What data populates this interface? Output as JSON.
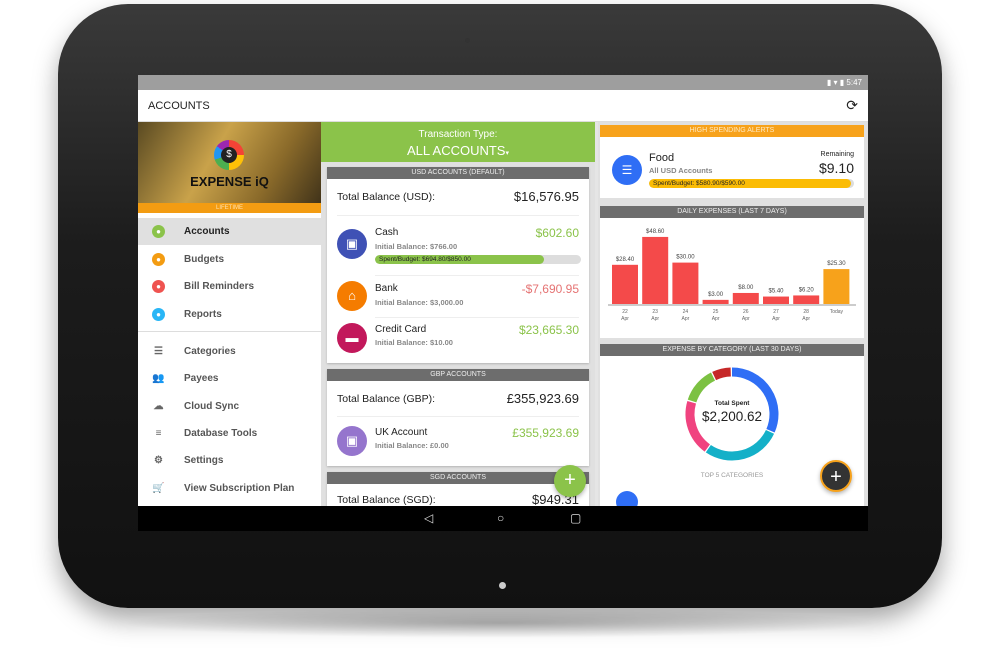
{
  "status_bar": {
    "time": "5:47"
  },
  "app_bar": {
    "title": "ACCOUNTS",
    "sync_icon": "sync-icon"
  },
  "sidebar": {
    "brand": "EXPENSE iQ",
    "plan": "LIFETIME",
    "items": [
      {
        "label": "Accounts",
        "icon": "bank-icon",
        "color": "#8bc34a",
        "active": true
      },
      {
        "label": "Budgets",
        "icon": "thumbs-up-icon",
        "color": "#f39c12"
      },
      {
        "label": "Bill Reminders",
        "icon": "alarm-icon",
        "color": "#ef5350"
      },
      {
        "label": "Reports",
        "icon": "chart-icon",
        "color": "#29b6f6"
      }
    ],
    "secondary": [
      {
        "label": "Categories",
        "icon": "list-icon"
      },
      {
        "label": "Payees",
        "icon": "people-icon"
      },
      {
        "label": "Cloud Sync",
        "icon": "cloud-icon"
      },
      {
        "label": "Database Tools",
        "icon": "database-icon"
      },
      {
        "label": "Settings",
        "icon": "gear-icon"
      },
      {
        "label": "View Subscription Plan",
        "icon": "cart-icon"
      }
    ]
  },
  "accounts": {
    "transaction_type_label": "Transaction Type:",
    "transaction_type_value": "ALL ACCOUNTS",
    "usd": {
      "header": "USD ACCOUNTS (DEFAULT)",
      "total_label": "Total Balance (USD):",
      "total": "$16,576.95",
      "items": [
        {
          "name": "Cash",
          "initial": "Initial Balance: $766.00",
          "balance": "$602.60",
          "color": "#3f51b5",
          "budget": "Spent/Budget: $694.80/$850.00",
          "budget_fraction": 0.82
        },
        {
          "name": "Bank",
          "initial": "Initial Balance: $3,000.00",
          "balance": "-$7,690.95",
          "color": "#f57c00"
        },
        {
          "name": "Credit Card",
          "initial": "Initial Balance: $10.00",
          "balance": "$23,665.30",
          "color": "#c2185b"
        }
      ]
    },
    "gbp": {
      "header": "GBP ACCOUNTS",
      "total_label": "Total Balance (GBP):",
      "total": "£355,923.69",
      "items": [
        {
          "name": "UK Account",
          "initial": "Initial Balance: £0.00",
          "balance": "£355,923.69",
          "color": "#9575cd"
        }
      ]
    },
    "sgd": {
      "header": "SGD ACCOUNTS",
      "total_label": "Total Balance (SGD):",
      "total": "$949.31"
    }
  },
  "alerts": {
    "header": "HIGH SPENDING ALERTS",
    "category": "Food",
    "scope": "All USD Accounts",
    "remaining_label": "Remaining",
    "remaining": "$9.10",
    "budget": "Spent/Budget: $580.90/$590.00",
    "budget_fraction": 0.985
  },
  "chart_data": [
    {
      "type": "bar",
      "title": "DAILY EXPENSES (LAST 7 DAYS)",
      "categories": [
        [
          "22",
          "Apr"
        ],
        [
          "23",
          "Apr"
        ],
        [
          "24",
          "Apr"
        ],
        [
          "25",
          "Apr"
        ],
        [
          "26",
          "Apr"
        ],
        [
          "27",
          "Apr"
        ],
        [
          "28",
          "Apr"
        ],
        [
          "Today",
          ""
        ]
      ],
      "values": [
        28.4,
        48.6,
        30.0,
        3.0,
        8.0,
        5.4,
        6.2,
        25.3
      ],
      "labels": [
        "$28.40",
        "$48.60",
        "$30.00",
        "$3.00",
        "$8.00",
        "$5.40",
        "$6.20",
        "$25.30"
      ],
      "colors": {
        "past": "#f44a4a",
        "today": "#f7a21b"
      }
    },
    {
      "type": "pie",
      "title": "EXPENSE BY CATEGORY (LAST 30 DAYS)",
      "center_label": "Total Spent",
      "center_value": "$2,200.62",
      "footer": "TOP 5 CATEGORIES",
      "shares": [
        0.32,
        0.28,
        0.2,
        0.13,
        0.07
      ],
      "colors": [
        "#2f6ef5",
        "#14b0c8",
        "#f0437f",
        "#7cc142",
        "#c62828"
      ]
    }
  ]
}
